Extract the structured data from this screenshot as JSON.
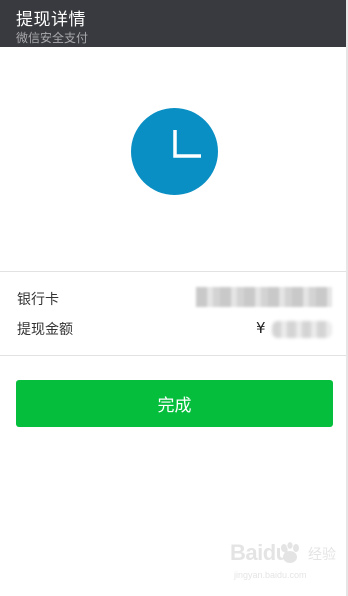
{
  "header": {
    "title": "提现详情",
    "subtitle": "微信安全支付",
    "background": "#393a3f"
  },
  "status_icon": {
    "name": "clock-icon",
    "color": "#0a8fc4"
  },
  "details": {
    "bank_card_label": "银行卡",
    "amount_label": "提现金额",
    "currency_symbol": "¥"
  },
  "actions": {
    "done_label": "完成",
    "done_color": "#04be3c"
  },
  "watermark": {
    "logo": "Baidu",
    "logo_suffix": "经验",
    "url": "jingyan.baidu.com"
  }
}
